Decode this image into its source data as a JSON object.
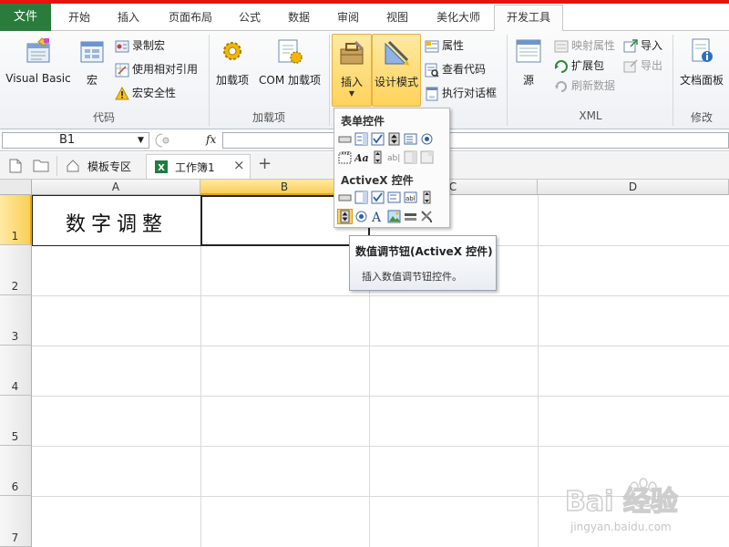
{
  "ribbon_tabs": [
    {
      "label": "文件"
    },
    {
      "label": "开始"
    },
    {
      "label": "插入"
    },
    {
      "label": "页面布局"
    },
    {
      "label": "公式"
    },
    {
      "label": "数据"
    },
    {
      "label": "审阅"
    },
    {
      "label": "视图"
    },
    {
      "label": "美化大师"
    },
    {
      "label": "开发工具"
    }
  ],
  "active_tab": "开发工具",
  "groups": {
    "code": {
      "label": "代码",
      "visual_basic": "Visual Basic",
      "macro": "宏",
      "record_macro": "录制宏",
      "relative_ref": "使用相对引用",
      "macro_security": "宏安全性"
    },
    "addins": {
      "label": "加载项",
      "addins": "加载项",
      "com_addins": "COM 加载项"
    },
    "controls": {
      "insert": "插入",
      "design_mode": "设计模式",
      "properties": "属性",
      "view_code": "查看代码",
      "run_dialog": "执行对话框"
    },
    "xml": {
      "label": "XML",
      "source": "源",
      "map_properties": "映射属性",
      "expansion_packs": "扩展包",
      "refresh_data": "刷新数据",
      "import": "导入",
      "export": "导出"
    },
    "modify": {
      "label": "修改",
      "document_panel": "文档面板"
    }
  },
  "formula_bar": {
    "name_box": "B1",
    "fx": "fx",
    "formula": ""
  },
  "workbook_tabs": {
    "template_zone": "模板专区",
    "workbook": "工作簿1",
    "close": "×",
    "add": "+"
  },
  "sheet": {
    "columns": [
      "A",
      "B",
      "C",
      "D"
    ],
    "rows": [
      "1",
      "2",
      "3",
      "4",
      "5",
      "6",
      "7"
    ],
    "selected_cell": "B1",
    "cells": {
      "A1": "数字调整"
    }
  },
  "dropdown": {
    "form_controls_label": "表单控件",
    "activex_controls_label": "ActiveX 控件"
  },
  "tooltip": {
    "title": "数值调节钮(ActiveX 控件)",
    "body": "插入数值调节钮控件。"
  },
  "watermark": {
    "text_top": "Bai 经验",
    "text_bottom": "jingyan.baidu.com"
  },
  "colors": {
    "file_tab": "#2a7c3c",
    "accent_red": "#e8120e",
    "selection": "#f9cf56",
    "highlight_border": "#e0b44a"
  }
}
